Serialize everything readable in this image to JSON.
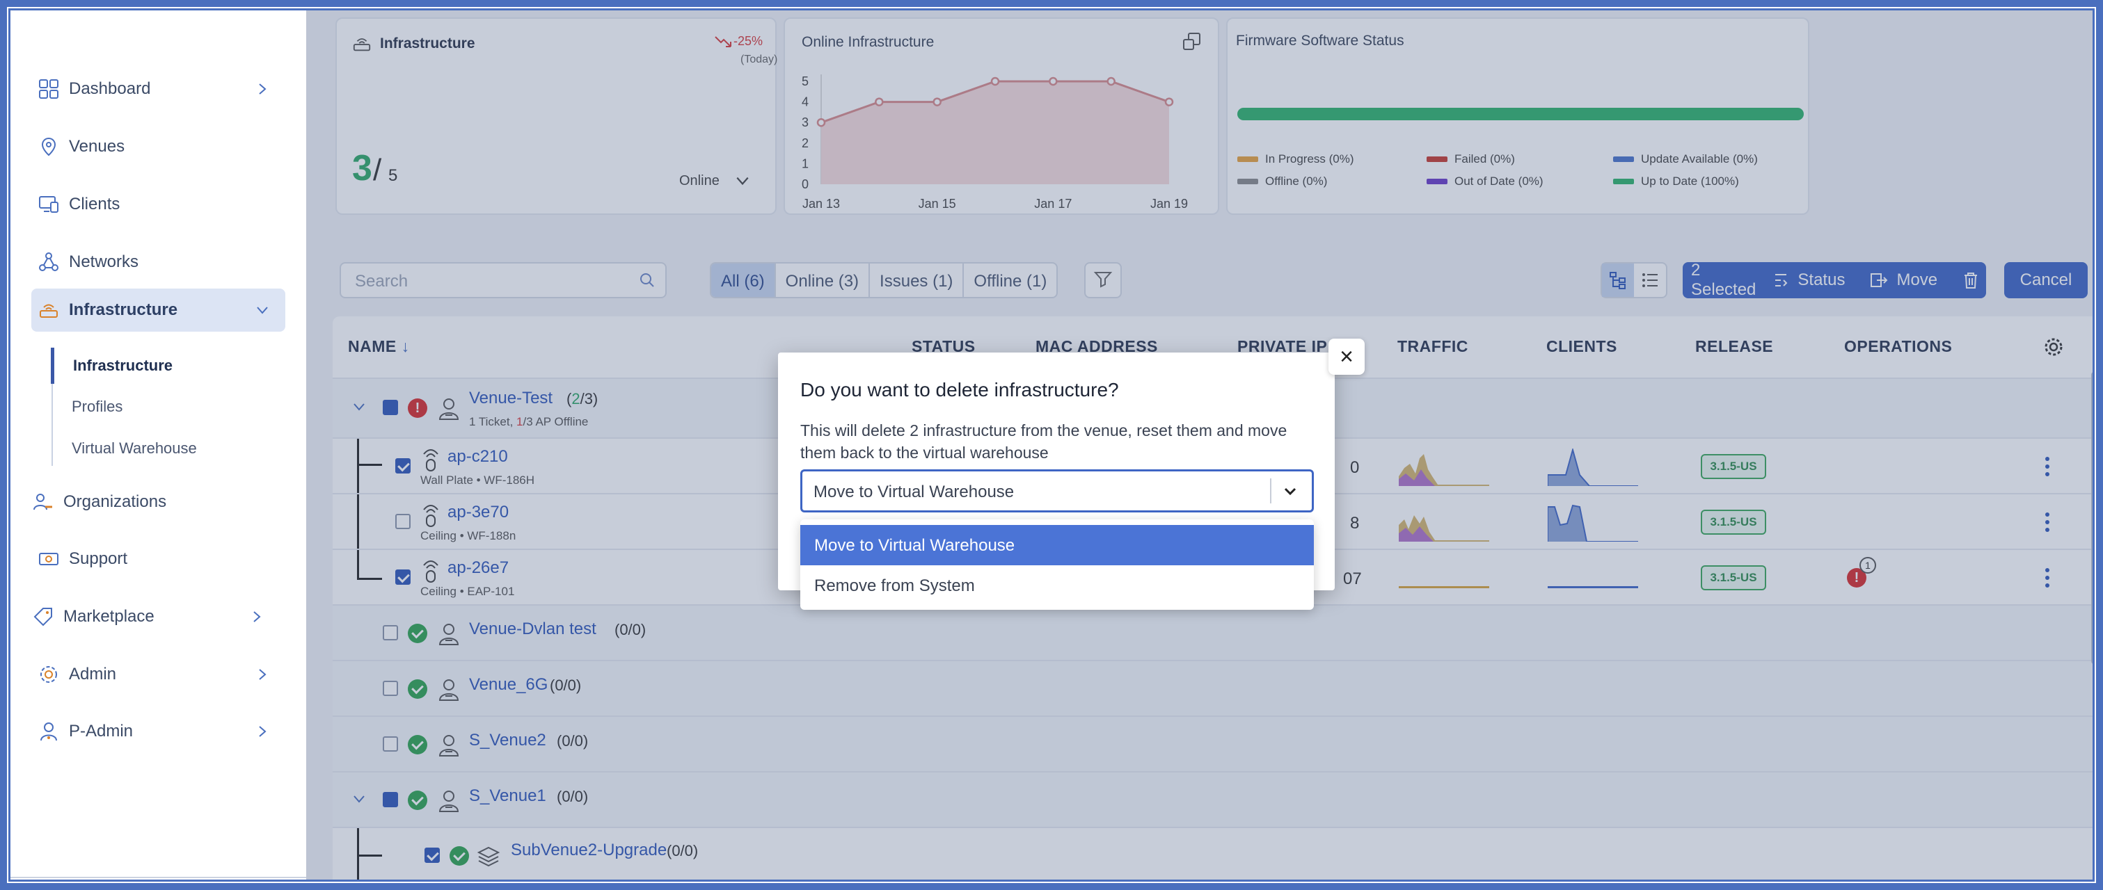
{
  "sidebar": {
    "items": [
      {
        "label": "Dashboard",
        "icon": "dashboard-icon",
        "has_chevron": true
      },
      {
        "label": "Venues",
        "icon": "location-pin-icon",
        "has_chevron": false
      },
      {
        "label": "Clients",
        "icon": "monitor-icon",
        "has_chevron": false
      },
      {
        "label": "Networks",
        "icon": "network-icon",
        "has_chevron": false
      },
      {
        "label": "Infrastructure",
        "icon": "router-icon",
        "has_chevron": true,
        "active": true
      },
      {
        "label": "Organizations",
        "icon": "organization-icon",
        "has_chevron": false
      },
      {
        "label": "Support",
        "icon": "ticket-icon",
        "has_chevron": false
      },
      {
        "label": "Marketplace",
        "icon": "tag-icon",
        "has_chevron": true
      },
      {
        "label": "Admin",
        "icon": "gear-icon",
        "has_chevron": true
      },
      {
        "label": "P-Admin",
        "icon": "user-admin-icon",
        "has_chevron": true
      }
    ],
    "sub_items": [
      {
        "label": "Infrastructure",
        "active": true
      },
      {
        "label": "Profiles"
      },
      {
        "label": "Virtual Warehouse"
      }
    ]
  },
  "cards": {
    "infrastructure": {
      "title": "Infrastructure",
      "trend": "-25%",
      "trend_sub": "(Today)",
      "value": "3",
      "total": "5",
      "select_label": "Online"
    },
    "online": {
      "title": "Online Infrastructure",
      "y_ticks": [
        "5",
        "4",
        "3",
        "2",
        "1",
        "0"
      ],
      "x_ticks": [
        "Jan 13",
        "Jan 15",
        "Jan 17",
        "Jan 19"
      ]
    },
    "firmware": {
      "title": "Firmware Software Status",
      "legend": [
        {
          "label": "In Progress (0%)",
          "color": "#e8a33d"
        },
        {
          "label": "Failed (0%)",
          "color": "#c83a2e"
        },
        {
          "label": "Update Available (0%)",
          "color": "#4a73c9"
        },
        {
          "label": "Offline (0%)",
          "color": "#8a8a8a"
        },
        {
          "label": "Out of Date (0%)",
          "color": "#6a3cc7"
        },
        {
          "label": "Up to Date (100%)",
          "color": "#2fb36b"
        }
      ]
    }
  },
  "chart_data": {
    "type": "area",
    "title": "Online Infrastructure",
    "x": [
      "Jan 13",
      "Jan 14",
      "Jan 15",
      "Jan 16",
      "Jan 17",
      "Jan 18",
      "Jan 19"
    ],
    "values": [
      3,
      4,
      4,
      5,
      5,
      5,
      4
    ],
    "ylim": [
      0,
      5
    ]
  },
  "toolbar": {
    "search_placeholder": "Search",
    "filters": [
      "All (6)",
      "Online (3)",
      "Issues (1)",
      "Offline (1)"
    ],
    "selected_label": "2 Selected",
    "status_label": "Status",
    "move_label": "Move",
    "cancel_label": "Cancel"
  },
  "table": {
    "headers": [
      "NAME",
      "STATUS",
      "MAC ADDRESS",
      "PRIVATE IP",
      "TRAFFIC",
      "CLIENTS",
      "RELEASE",
      "OPERATIONS"
    ],
    "venue_test": {
      "name": "Venue-Test",
      "count_open": "(",
      "count_a": "2",
      "count_b": "/3)",
      "sub": "1 Ticket, ",
      "sub_red": "1",
      "sub_rest": "/3 AP Offline"
    },
    "aps": [
      {
        "name": "ap-c210",
        "sub": "Wall Plate • WF-186H",
        "ip_tail": "0",
        "release": "3.1.5-US"
      },
      {
        "name": "ap-3e70",
        "sub": "Ceiling • WF-188n",
        "ip_tail": "8",
        "release": "3.1.5-US"
      },
      {
        "name": "ap-26e7",
        "sub": "Ceiling • EAP-101",
        "ip_tail": "07",
        "release": "3.1.5-US",
        "alert_count": "1"
      }
    ],
    "venues": [
      {
        "name": "Venue-Dvlan test",
        "count": "(0/0)"
      },
      {
        "name": "Venue_6G",
        "count": "(0/0)"
      },
      {
        "name": "S_Venue2",
        "count": "(0/0)"
      },
      {
        "name": "S_Venue1",
        "count": "(0/0)"
      }
    ],
    "subvenue": {
      "name": "SubVenue2-Upgrade",
      "count": "(0/0)"
    }
  },
  "modal": {
    "title": "Do you want to delete infrastructure?",
    "description": "This will delete 2 infrastructure from the venue, reset them and move them back to the virtual warehouse",
    "selected": "Move to Virtual Warehouse",
    "options": [
      "Move to Virtual Warehouse",
      "Remove from System"
    ]
  }
}
